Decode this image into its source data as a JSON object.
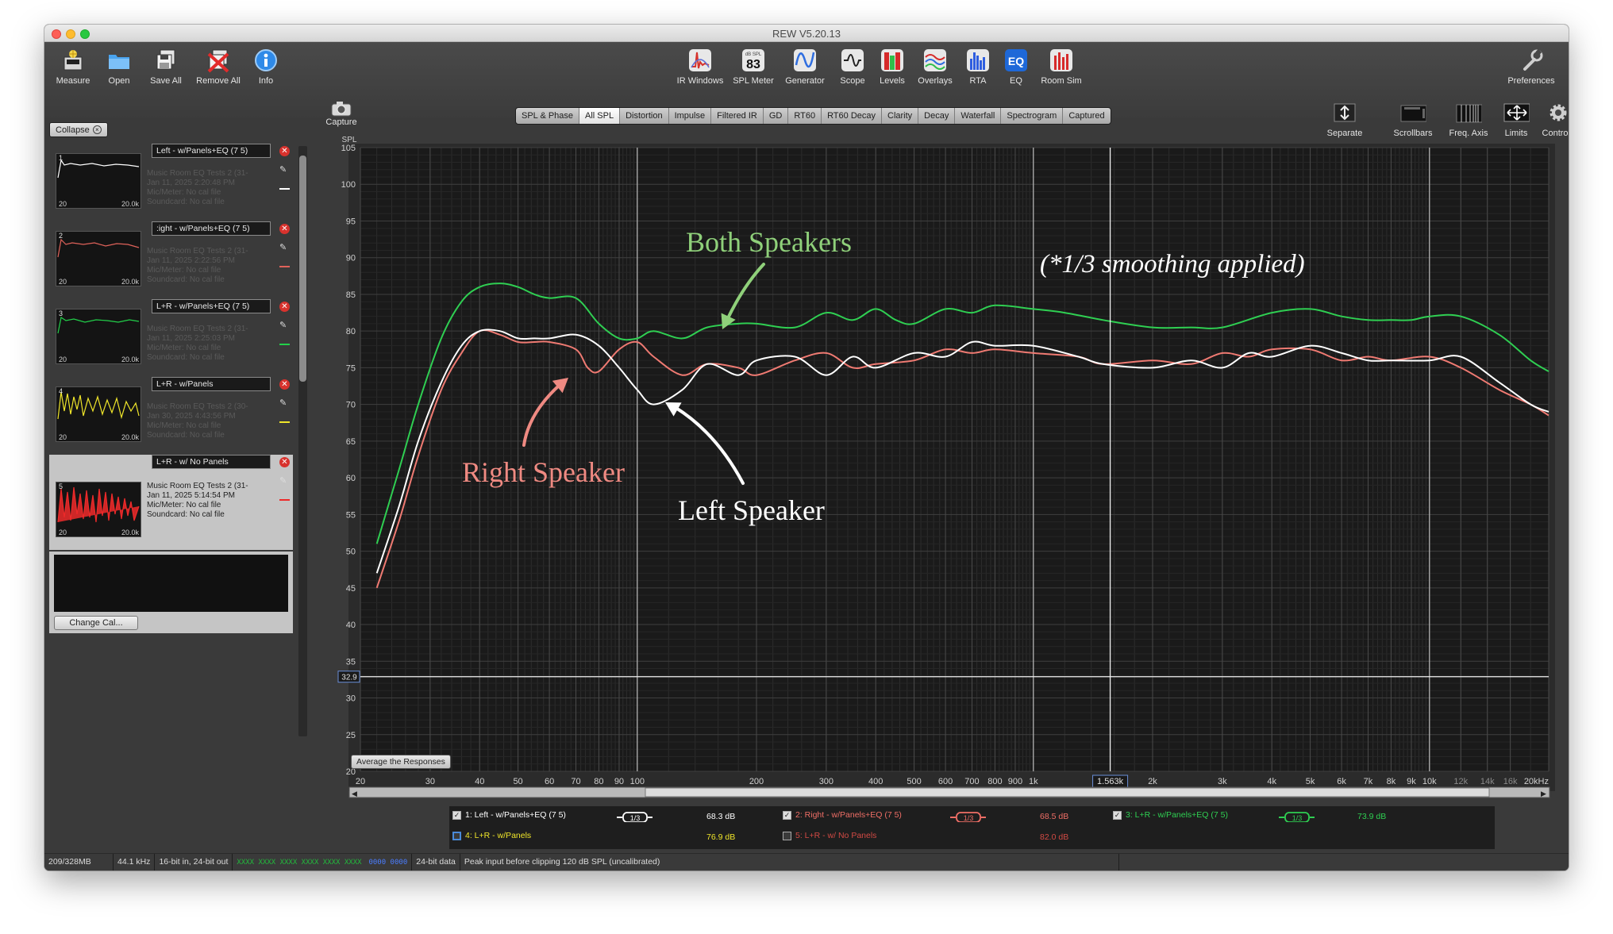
{
  "window": {
    "title": "REW V5.20.13"
  },
  "toolbar": {
    "left": [
      {
        "label": "Measure",
        "icon": "measure-icon"
      },
      {
        "label": "Open",
        "icon": "folder-icon"
      },
      {
        "label": "Save All",
        "icon": "save-all-icon"
      },
      {
        "label": "Remove All",
        "icon": "remove-all-icon"
      },
      {
        "label": "Info",
        "icon": "info-icon"
      }
    ],
    "center": [
      {
        "label": "IR Windows",
        "icon": "ir-windows-icon"
      },
      {
        "label": "SPL Meter",
        "icon": "spl-meter-icon",
        "badge_top": "dB SPL",
        "badge_value": "83"
      },
      {
        "label": "Generator",
        "icon": "generator-icon"
      },
      {
        "label": "Scope",
        "icon": "scope-icon"
      },
      {
        "label": "Levels",
        "icon": "levels-icon"
      },
      {
        "label": "Overlays",
        "icon": "overlays-icon"
      },
      {
        "label": "RTA",
        "icon": "rta-icon"
      },
      {
        "label": "EQ",
        "icon": "eq-icon",
        "badge_value": "EQ"
      },
      {
        "label": "Room Sim",
        "icon": "room-sim-icon"
      }
    ],
    "preferences": {
      "label": "Preferences",
      "icon": "wrench-icon"
    }
  },
  "graph_toolbar": {
    "capture": "Capture",
    "right": [
      {
        "label": "Separate",
        "icon": "separate-icon"
      },
      {
        "label": "Scrollbars",
        "icon": "scrollbars-icon"
      },
      {
        "label": "Freq. Axis",
        "icon": "freq-axis-icon"
      },
      {
        "label": "Limits",
        "icon": "limits-icon"
      },
      {
        "label": "Controls",
        "icon": "gear-icon"
      }
    ]
  },
  "tabs": [
    {
      "label": "SPL & Phase",
      "active": false
    },
    {
      "label": "All SPL",
      "active": true
    },
    {
      "label": "Distortion",
      "active": false
    },
    {
      "label": "Impulse",
      "active": false
    },
    {
      "label": "Filtered IR",
      "active": false
    },
    {
      "label": "GD",
      "active": false
    },
    {
      "label": "RT60",
      "active": false
    },
    {
      "label": "RT60 Decay",
      "active": false
    },
    {
      "label": "Clarity",
      "active": false
    },
    {
      "label": "Decay",
      "active": false
    },
    {
      "label": "Waterfall",
      "active": false
    },
    {
      "label": "Spectrogram",
      "active": false
    },
    {
      "label": "Captured",
      "active": false
    }
  ],
  "left_panel": {
    "collapse_label": "Collapse",
    "measurements": [
      {
        "num": "1",
        "name": "Left - w/Panels+EQ (7 5)",
        "info": [
          "Music Room EQ Tests 2 (31-",
          "Jan 11, 2025 2:20:48 PM",
          "Mic/Meter: No cal file",
          "Soundcard: No cal file"
        ],
        "thumb_color": "#ffffff",
        "axis_start": "20",
        "axis_end": "20.0k",
        "selected": false
      },
      {
        "num": "2",
        "name": ":ight - w/Panels+EQ (7 5)",
        "info": [
          "Music Room EQ Tests 2 (31-",
          "Jan 11, 2025 2:22:56 PM",
          "Mic/Meter: No cal file",
          "Soundcard: No cal file"
        ],
        "thumb_color": "#e0625a",
        "axis_start": "20",
        "axis_end": "20.0k",
        "selected": false
      },
      {
        "num": "3",
        "name": "L+R - w/Panels+EQ (7 5)",
        "info": [
          "Music Room EQ Tests 2 (31-",
          "Jan 11, 2025 2:25:03 PM",
          "Mic/Meter: No cal file",
          "Soundcard: No cal file"
        ],
        "thumb_color": "#22d04a",
        "axis_start": "20",
        "axis_end": "20.0k",
        "selected": false
      },
      {
        "num": "4",
        "name": "L+R - w/Panels",
        "info": [
          "Music Room EQ Tests 2 (30-",
          "Jan 30, 2025 4:43:56 PM",
          "Mic/Meter: No cal file",
          "Soundcard: No cal file"
        ],
        "thumb_color": "#f0e62a",
        "axis_start": "20",
        "axis_end": "20.0k",
        "selected": false
      },
      {
        "num": "5",
        "name": "L+R - w/ No Panels",
        "info": [
          "Music Room EQ Tests 2 (31-",
          "Jan 11, 2025 5:14:54 PM",
          "Mic/Meter: No cal file",
          "Soundcard: No cal file"
        ],
        "thumb_color": "#ee2a2a",
        "axis_start": "20",
        "axis_end": "20.0k",
        "selected": true
      }
    ],
    "change_cal_label": "Change Cal..."
  },
  "graph": {
    "y_axis_title": "SPL",
    "y_ticks": [
      "105",
      "100",
      "95",
      "90",
      "85",
      "80",
      "75",
      "70",
      "65",
      "60",
      "55",
      "50",
      "45",
      "40",
      "35",
      "30",
      "25",
      "20"
    ],
    "x_ticks": [
      "20",
      "30",
      "40",
      "50",
      "60",
      "70",
      "80",
      "90",
      "100",
      "200",
      "300",
      "400",
      "500",
      "600",
      "700",
      "800",
      "900",
      "1k",
      "2k",
      "3k",
      "4k",
      "5k",
      "6k",
      "7k",
      "8k",
      "9k",
      "10k",
      "12k",
      "14k",
      "16k",
      "20kHz"
    ],
    "cursor_freq_label": "1.563k",
    "cursor_level_label": "32.9",
    "average_button": "Average the Responses",
    "annotations": {
      "both": "Both Speakers",
      "right": "Right Speaker",
      "left": "Left Speaker",
      "smoothing": "(*1/3 smoothing applied)"
    }
  },
  "chart_data": {
    "type": "line",
    "title": "",
    "xlabel": "",
    "ylabel": "SPL",
    "x_scale": "log",
    "xlim": [
      20,
      20000
    ],
    "ylim": [
      20,
      105
    ],
    "grid": true,
    "series": [
      {
        "name": "1: Left - w/Panels+EQ (7 5)",
        "color": "#ffffff",
        "x": [
          22,
          25,
          28,
          32,
          36,
          40,
          45,
          50,
          55,
          60,
          70,
          80,
          90,
          100,
          110,
          130,
          150,
          180,
          200,
          250,
          300,
          350,
          400,
          500,
          600,
          700,
          800,
          1000,
          1300,
          1500,
          2000,
          2500,
          3000,
          3500,
          4000,
          5000,
          6000,
          7000,
          8000,
          10000,
          12000,
          15000,
          18000,
          20000
        ],
        "y": [
          47,
          56,
          65,
          73,
          78,
          80,
          80,
          79,
          79,
          79,
          79.5,
          78,
          75,
          72,
          70,
          72,
          75.5,
          74,
          76,
          76.5,
          74,
          76.5,
          75,
          77,
          76.5,
          78.5,
          78,
          78,
          76.5,
          75.5,
          75,
          76,
          75,
          77,
          76.5,
          78,
          77,
          76,
          76,
          76,
          76.5,
          73,
          70,
          69
        ]
      },
      {
        "name": "2: Right - w/Panels+EQ (7 5)",
        "color": "#ef7a72",
        "x": [
          22,
          25,
          28,
          32,
          36,
          40,
          45,
          50,
          55,
          60,
          70,
          75,
          80,
          90,
          100,
          110,
          130,
          150,
          180,
          200,
          250,
          300,
          350,
          400,
          500,
          600,
          700,
          800,
          1000,
          1300,
          1500,
          2000,
          2500,
          3000,
          3500,
          4000,
          5000,
          6000,
          7000,
          8000,
          10000,
          12000,
          15000,
          18000,
          20000
        ],
        "y": [
          45,
          54,
          63,
          72,
          77,
          80,
          79.5,
          78.5,
          78.5,
          78.5,
          77.5,
          75,
          74.5,
          77.5,
          78.5,
          76.5,
          74,
          75.5,
          75,
          74,
          76,
          77,
          75,
          75.5,
          76,
          77.5,
          77,
          77.5,
          77,
          76.5,
          75.5,
          76,
          75.5,
          77,
          76.5,
          77.5,
          77.5,
          76,
          76.5,
          76,
          76.5,
          75,
          72,
          70,
          68.5
        ]
      },
      {
        "name": "3: L+R - w/Panels+EQ (7 5)",
        "color": "#2fcf52",
        "x": [
          22,
          25,
          28,
          32,
          36,
          40,
          45,
          50,
          55,
          60,
          70,
          80,
          90,
          100,
          110,
          130,
          150,
          180,
          200,
          250,
          300,
          350,
          400,
          450,
          500,
          600,
          700,
          800,
          1000,
          1200,
          1500,
          2000,
          2500,
          3000,
          4000,
          5000,
          6000,
          7000,
          8000,
          9000,
          10000,
          12000,
          15000,
          18000,
          20000
        ],
        "y": [
          51,
          61,
          70,
          79,
          84,
          86,
          86.5,
          86,
          85,
          84.5,
          84.5,
          81,
          79,
          79,
          80,
          79,
          80.5,
          81,
          81,
          80.5,
          82.5,
          81.5,
          83,
          81.5,
          81,
          83,
          82.5,
          83.5,
          83,
          82.5,
          81.5,
          80.5,
          80.5,
          80.5,
          82.5,
          83,
          82,
          81.5,
          81.5,
          81.5,
          82,
          82,
          79.5,
          76,
          74.5
        ]
      }
    ]
  },
  "legend": [
    {
      "label": "1: Left - w/Panels+EQ (7 5)",
      "value": "68.3 dB",
      "color": "#ffffff",
      "checked": true,
      "smoothing": "1/3"
    },
    {
      "label": "2: Right - w/Panels+EQ (7 5)",
      "value": "68.5 dB",
      "color": "#ef6e66",
      "checked": true,
      "smoothing": "1/3"
    },
    {
      "label": "3: L+R - w/Panels+EQ (7 5)",
      "value": "73.9 dB",
      "color": "#2fcf52",
      "checked": true,
      "smoothing": "1/3"
    },
    {
      "label": "4: L+R - w/Panels",
      "value": "76.9 dB",
      "color": "#f0e62a",
      "checked": false,
      "smoothing": ""
    },
    {
      "label": "5: L+R - w/ No Panels",
      "value": "82.0 dB",
      "color": "#ee3a3a",
      "checked": false,
      "smoothing": ""
    }
  ],
  "status_bar": {
    "memory": "209/328MB",
    "sample_rate": "44.1 kHz",
    "bit_depth": "16-bit in, 24-bit out",
    "input_meter": "XXXX XXXX   XXXX XXXX   XXXX XXXX",
    "input_meter_blue": "0000 0000",
    "data_bits": "24-bit data",
    "peak": "Peak input before clipping 120 dB SPL (uncalibrated)"
  }
}
